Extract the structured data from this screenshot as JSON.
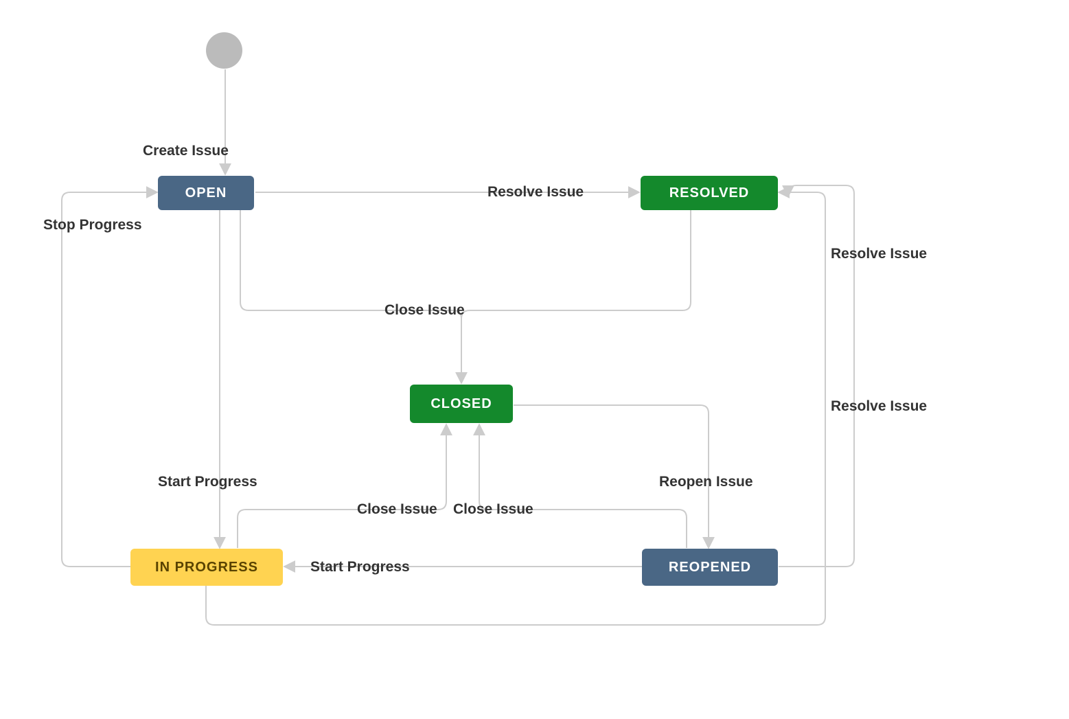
{
  "states": {
    "open": {
      "label": "OPEN"
    },
    "resolved": {
      "label": "RESOLVED"
    },
    "closed": {
      "label": "CLOSED"
    },
    "in_progress": {
      "label": "IN PROGRESS"
    },
    "reopened": {
      "label": "REOPENED"
    }
  },
  "transitions": {
    "create_issue": "Create Issue",
    "resolve_issue": "Resolve Issue",
    "resolve_issue_right1": "Resolve Issue",
    "resolve_issue_right2": "Resolve Issue",
    "close_issue_top": "Close Issue",
    "close_issue_left": "Close Issue",
    "close_issue_right": "Close Issue",
    "reopen_issue": "Reopen Issue",
    "start_progress_left": "Start Progress",
    "start_progress_mid": "Start Progress",
    "stop_progress": "Stop Progress"
  },
  "chart_data": {
    "type": "state-diagram",
    "title": "",
    "nodes": [
      {
        "id": "start",
        "type": "initial",
        "label": ""
      },
      {
        "id": "open",
        "type": "state",
        "label": "OPEN",
        "color": "blue"
      },
      {
        "id": "resolved",
        "type": "state",
        "label": "RESOLVED",
        "color": "green"
      },
      {
        "id": "closed",
        "type": "state",
        "label": "CLOSED",
        "color": "green"
      },
      {
        "id": "in_progress",
        "type": "state",
        "label": "IN PROGRESS",
        "color": "yellow"
      },
      {
        "id": "reopened",
        "type": "state",
        "label": "REOPENED",
        "color": "blue"
      }
    ],
    "edges": [
      {
        "from": "start",
        "to": "open",
        "label": "Create Issue"
      },
      {
        "from": "open",
        "to": "resolved",
        "label": "Resolve Issue"
      },
      {
        "from": "open",
        "to": "closed",
        "label": "Close Issue"
      },
      {
        "from": "resolved",
        "to": "closed",
        "label": "Close Issue"
      },
      {
        "from": "open",
        "to": "in_progress",
        "label": "Start Progress"
      },
      {
        "from": "in_progress",
        "to": "open",
        "label": "Stop Progress"
      },
      {
        "from": "in_progress",
        "to": "closed",
        "label": "Close Issue"
      },
      {
        "from": "in_progress",
        "to": "resolved",
        "label": "Resolve Issue"
      },
      {
        "from": "closed",
        "to": "reopened",
        "label": "Reopen Issue"
      },
      {
        "from": "reopened",
        "to": "in_progress",
        "label": "Start Progress"
      },
      {
        "from": "reopened",
        "to": "closed",
        "label": "Close Issue"
      },
      {
        "from": "reopened",
        "to": "resolved",
        "label": "Resolve Issue"
      }
    ]
  }
}
